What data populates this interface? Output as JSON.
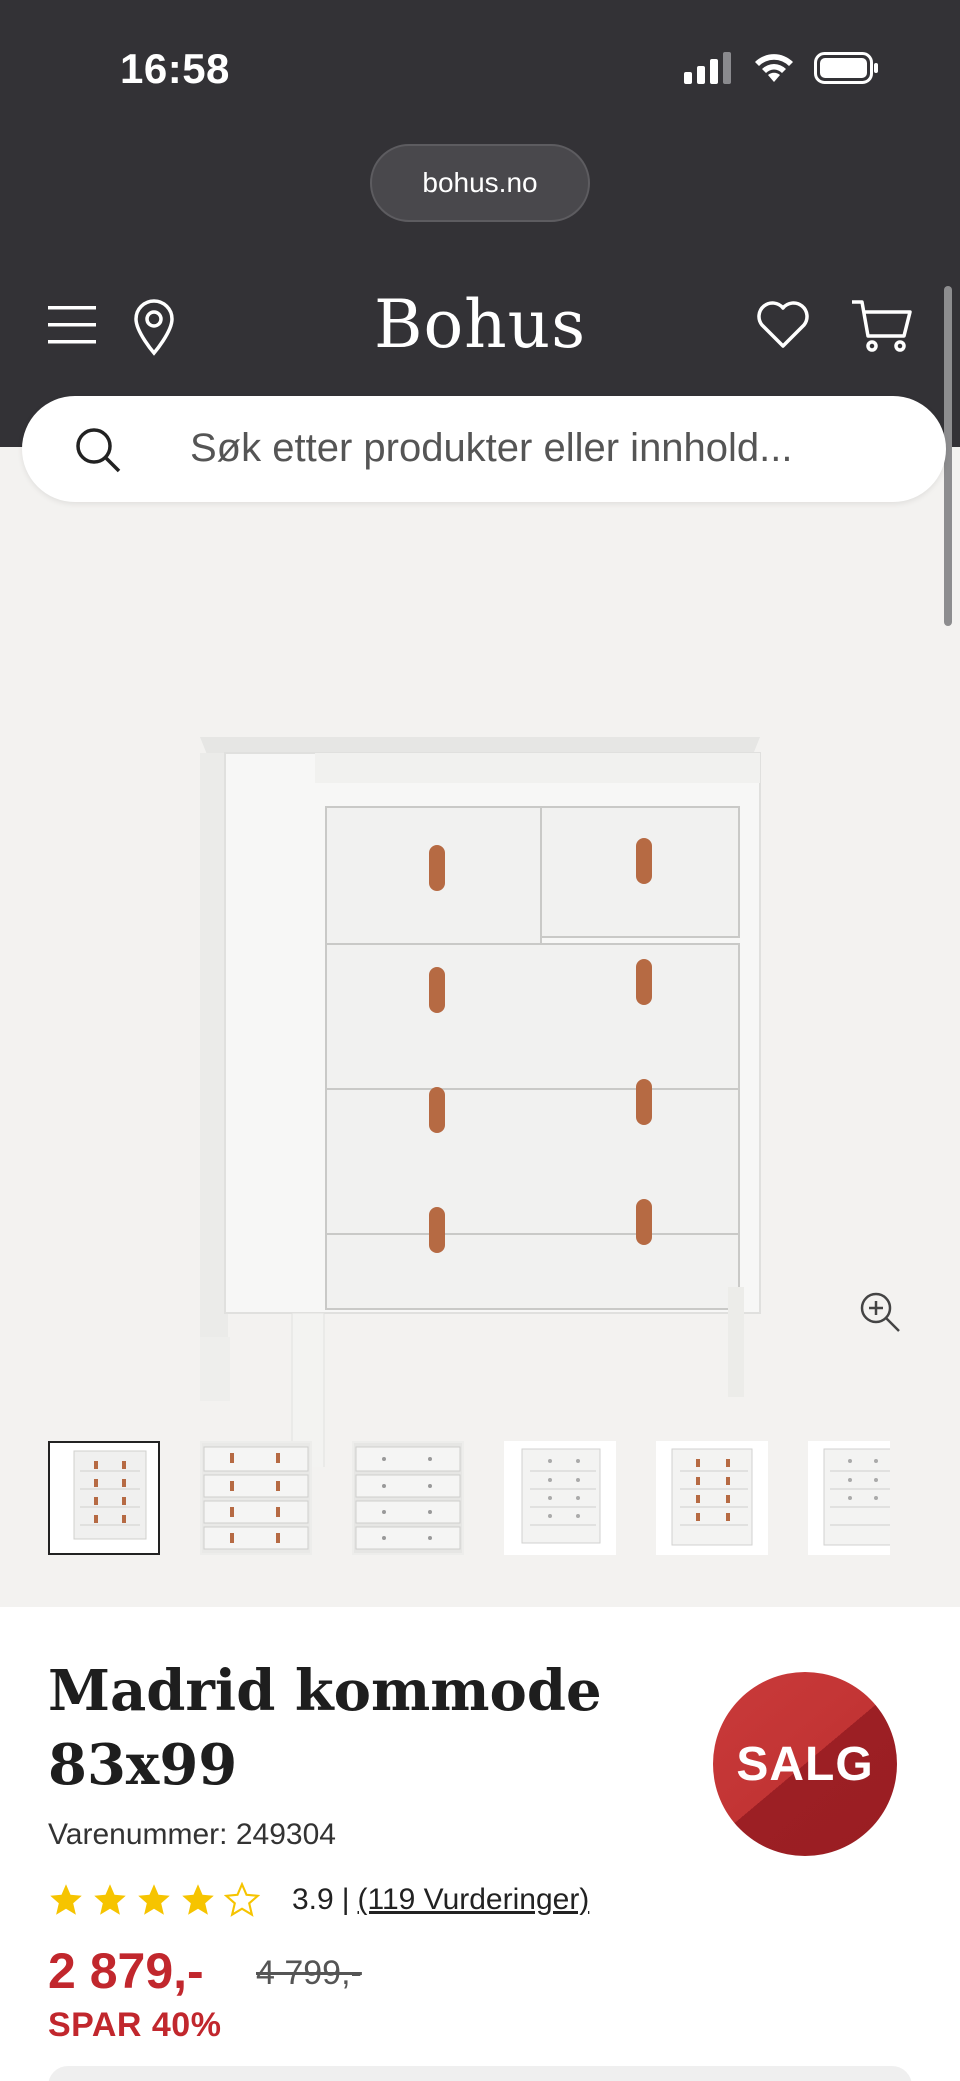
{
  "status": {
    "time": "16:58"
  },
  "browser": {
    "url": "bohus.no"
  },
  "header": {
    "logo": "Bohus"
  },
  "search": {
    "placeholder": "Søk etter produkter eller innhold..."
  },
  "product": {
    "title_line1": "Madrid kommode",
    "title_line2": "83x99",
    "sku": "Varenummer: 249304",
    "badge": "SALG",
    "rating": {
      "value": "3.9",
      "separator": "|",
      "reviews": "(119 Vurderinger)",
      "stars_filled": 4,
      "stars_total": 5
    },
    "price": "2 879,-",
    "old_price": "4 799,-",
    "save": "SPAR 40%"
  },
  "colors": {
    "header_bg": "#333236",
    "sale_red": "#c1272d",
    "star": "#f6c400"
  }
}
